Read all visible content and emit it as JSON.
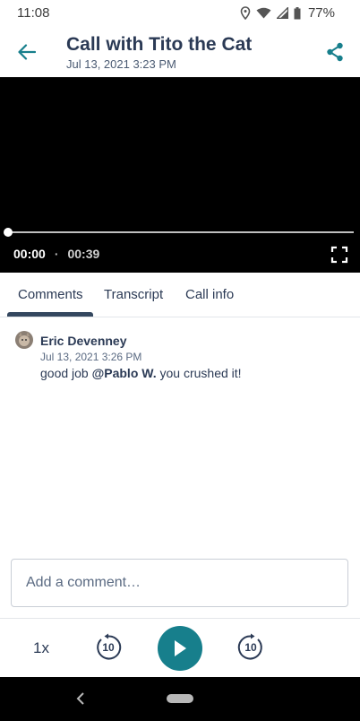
{
  "status_bar": {
    "time": "11:08",
    "battery": "77%",
    "icons": [
      "location-icon",
      "wifi-icon",
      "signal-icon",
      "battery-icon"
    ]
  },
  "header": {
    "title": "Call with Tito the Cat",
    "subtitle": "Jul 13, 2021 3:23 PM",
    "back_icon": "arrow-left-icon",
    "share_icon": "share-icon",
    "accent_color": "#177f8c"
  },
  "player": {
    "current_time": "00:00",
    "separator": "·",
    "duration": "00:39",
    "progress": 0,
    "fullscreen_icon": "fullscreen-icon"
  },
  "tabs": [
    {
      "label": "Comments",
      "active": true
    },
    {
      "label": "Transcript",
      "active": false
    },
    {
      "label": "Call info",
      "active": false
    }
  ],
  "comments": [
    {
      "author": "Eric Devenney",
      "date": "Jul 13, 2021 3:26 PM",
      "text_before": "good job ",
      "mention": "@Pablo W.",
      "text_after": " you crushed it!"
    }
  ],
  "comment_input": {
    "placeholder": "Add a comment…",
    "value": ""
  },
  "controls": {
    "speed": "1x",
    "rewind_seconds": "10",
    "forward_seconds": "10",
    "play_color": "#177f8c"
  }
}
